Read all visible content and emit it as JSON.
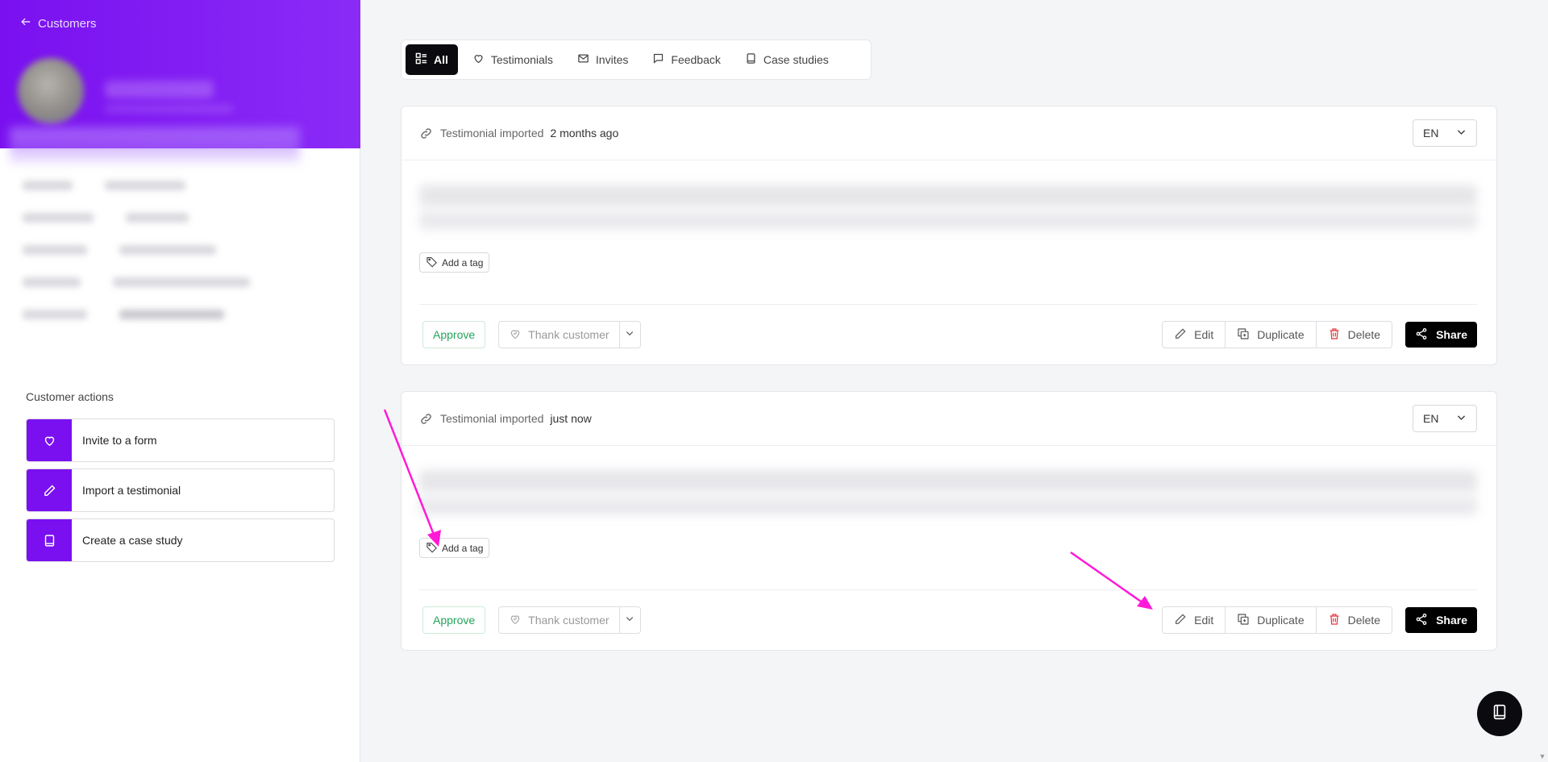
{
  "sidebar": {
    "back_label": "Customers",
    "actions_title": "Customer actions",
    "actions": [
      {
        "label": "Invite to a form",
        "icon": "heart-icon"
      },
      {
        "label": "Import a testimonial",
        "icon": "pencil-icon"
      },
      {
        "label": "Create a case study",
        "icon": "book-icon"
      }
    ]
  },
  "tabs": [
    {
      "label": "All",
      "icon": "grid-list-icon",
      "active": true
    },
    {
      "label": "Testimonials",
      "icon": "heart-icon"
    },
    {
      "label": "Invites",
      "icon": "mail-icon"
    },
    {
      "label": "Feedback",
      "icon": "chat-bubble-icon"
    },
    {
      "label": "Case studies",
      "icon": "book-icon"
    }
  ],
  "cards": [
    {
      "status": "Testimonial imported",
      "time": "2 months ago",
      "lang": "EN",
      "tag_label": "Add a tag",
      "approve": "Approve",
      "thank": "Thank customer",
      "edit": "Edit",
      "duplicate": "Duplicate",
      "delete": "Delete",
      "share": "Share"
    },
    {
      "status": "Testimonial imported",
      "time": "just now",
      "lang": "EN",
      "tag_label": "Add a tag",
      "approve": "Approve",
      "thank": "Thank customer",
      "edit": "Edit",
      "duplicate": "Duplicate",
      "delete": "Delete",
      "share": "Share"
    }
  ],
  "colors": {
    "brand": "#7a10f0",
    "approve": "#22a45a",
    "delete": "#e0343a",
    "annotation": "#ff19d6"
  }
}
